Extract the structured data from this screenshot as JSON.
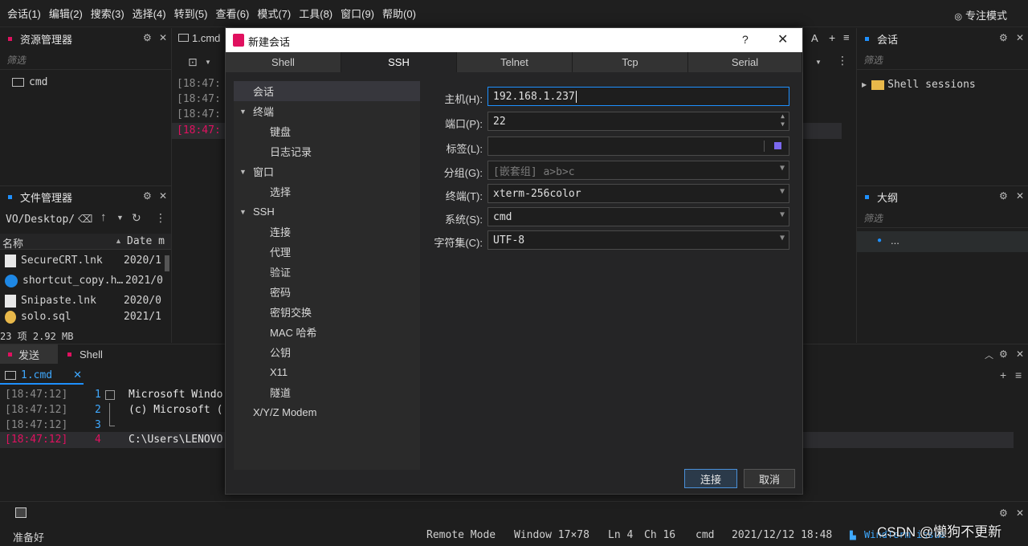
{
  "menu": [
    "会话(1)",
    "编辑(2)",
    "搜索(3)",
    "选择(4)",
    "转到(5)",
    "查看(6)",
    "模式(7)",
    "工具(8)",
    "窗口(9)",
    "帮助(0)"
  ],
  "focus_mode": "专注模式",
  "left": {
    "explorer_title": "资源管理器",
    "filter": "筛选",
    "explorer_item": "cmd",
    "files_title": "文件管理器",
    "path": "VO/Desktop/",
    "col_name": "名称",
    "col_date": "Date m",
    "files": [
      {
        "name": "SecureCRT.lnk",
        "date": "2020/1"
      },
      {
        "name": "shortcut_copy.h…",
        "date": "2021/0"
      },
      {
        "name": "Snipaste.lnk",
        "date": "2020/0"
      },
      {
        "name": "solo.sql",
        "date": "2021/1"
      }
    ],
    "count": "23 项 2.92 MB"
  },
  "editor": {
    "tab": "1.cmd",
    "tools": [
      "A",
      "+",
      "≡"
    ],
    "lines": [
      "[18:47:",
      "[18:47:",
      "[18:47:",
      "[18:47:"
    ]
  },
  "right": {
    "sessions_title": "会话",
    "filter": "筛选",
    "shell_sessions": "Shell sessions",
    "outline_title": "大纲",
    "outline_item": "..."
  },
  "bottom": {
    "send_tab": "发送",
    "shell_tab": "Shell",
    "term_tab": "1.cmd",
    "rows": [
      {
        "ts": "[18:47:12]",
        "num": "1",
        "text": "Microsoft Windo"
      },
      {
        "ts": "[18:47:12]",
        "num": "2",
        "text": "(c) Microsoft ("
      },
      {
        "ts": "[18:47:12]",
        "num": "3",
        "text": ""
      },
      {
        "ts": "[18:47:12]",
        "num": "4",
        "text": "C:\\Users\\LENOVO"
      }
    ]
  },
  "dialog": {
    "title": "新建会话",
    "help": "?",
    "tabs": [
      "Shell",
      "SSH",
      "Telnet",
      "Tcp",
      "Serial"
    ],
    "tree": [
      "会话",
      "终端",
      "键盘",
      "日志记录",
      "窗口",
      "选择",
      "SSH",
      "连接",
      "代理",
      "验证",
      "密码",
      "密钥交换",
      "MAC 哈希",
      "公钥",
      "X11",
      "隧道",
      "X/Y/Z Modem"
    ],
    "fields": {
      "host_label": "主机(H):",
      "host": "192.168.1.237",
      "port_label": "端口(P):",
      "port": "22",
      "tag_label": "标签(L):",
      "tag": "",
      "group_label": "分组(G):",
      "group": "[嵌套组] a>b>c",
      "term_label": "终端(T):",
      "term": "xterm-256color",
      "sys_label": "系统(S):",
      "sys": "cmd",
      "charset_label": "字符集(C):",
      "charset": "UTF-8"
    },
    "connect": "连接",
    "cancel": "取消"
  },
  "status": {
    "ready": "准备好",
    "mode": "Remote Mode",
    "window": "Window 17×78",
    "ln": "Ln 4",
    "ch": "Ch 16",
    "shell": "cmd",
    "datetime": "2021/12/12 18:48",
    "app": "WindTerm issue",
    "watermark": "CSDN @懒狗不更新"
  },
  "colors": {
    "accent": "#e0115f",
    "blue": "#1e90ff",
    "folder": "#e8b84a"
  }
}
